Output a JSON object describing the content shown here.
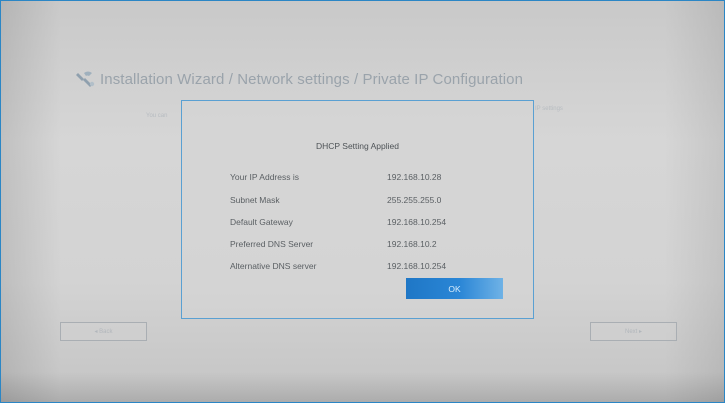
{
  "wizard": {
    "title": "Installation Wizard / Network settings / Private IP Configuration",
    "intro_left": "You can",
    "intro_right": "IP settings"
  },
  "dialog": {
    "title": "DHCP Setting Applied",
    "rows": [
      {
        "label": "Your IP Address is",
        "value": "192.168.10.28"
      },
      {
        "label": "Subnet Mask",
        "value": "255.255.255.0"
      },
      {
        "label": "Default Gateway",
        "value": "192.168.10.254"
      },
      {
        "label": "Preferred DNS Server",
        "value": "192.168.10.2"
      },
      {
        "label": "Alternative DNS server",
        "value": "192.168.10.254"
      }
    ],
    "ok_label": "OK"
  },
  "nav": {
    "back_label": "◂ Back",
    "next_label": "Next ▸"
  },
  "colors": {
    "accent": "#2a86d6",
    "border_accent": "#5aa0d2"
  },
  "icons": {
    "wizard": "wizard-tools-icon"
  }
}
